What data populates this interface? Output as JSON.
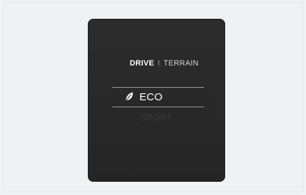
{
  "display": {
    "tabs": {
      "active": "DRIVE",
      "separator": "I",
      "inactive": "TERRAIN"
    },
    "modes": {
      "selected": {
        "label": "ECO",
        "icon": "leaf-icon"
      },
      "next": {
        "label": "SPORT"
      }
    }
  },
  "colors": {
    "screen_background": "#262626",
    "page_background": "#f1f2f3",
    "text_active": "#ffffff",
    "text_dimmed": "#3b3b3b"
  }
}
